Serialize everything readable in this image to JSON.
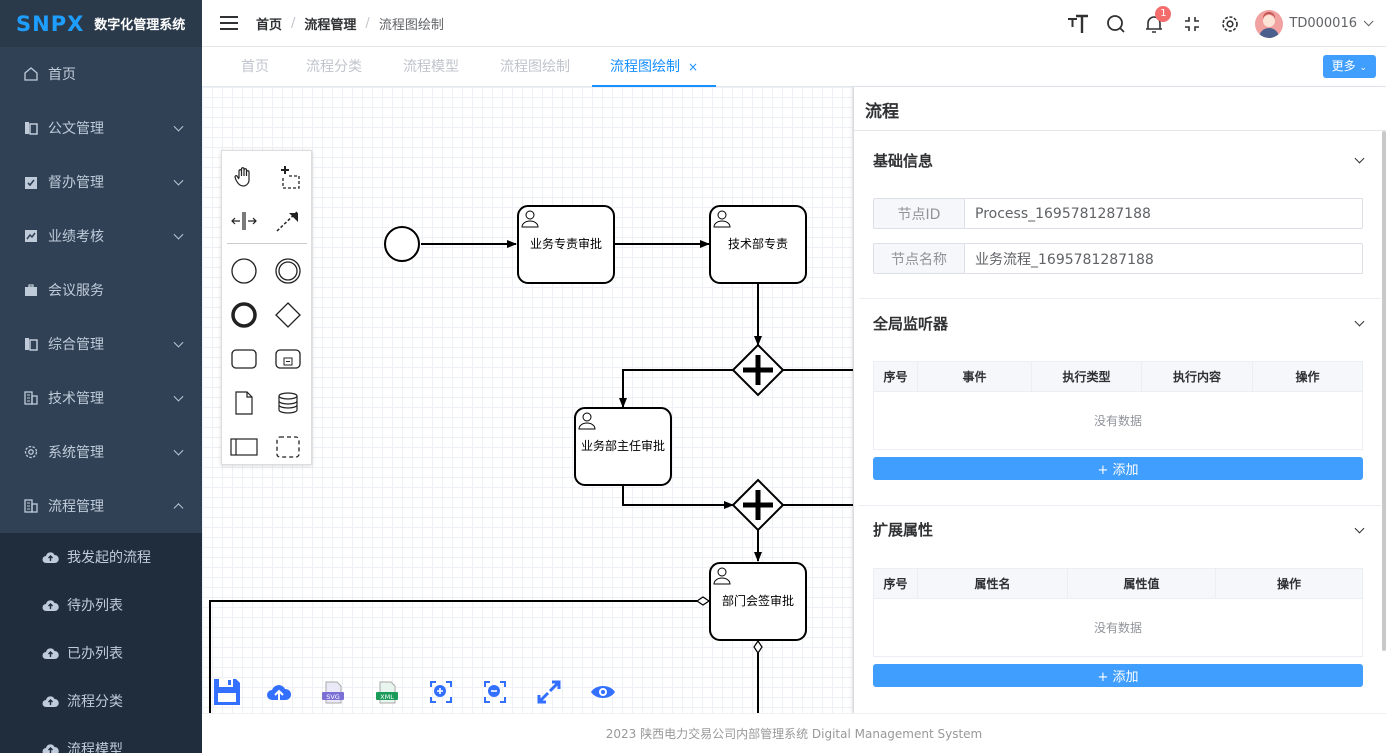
{
  "app": {
    "logo": "SNPX",
    "title": "数字化管理系统"
  },
  "sidebar": {
    "items": [
      {
        "label": "首页",
        "icon": "home-icon"
      },
      {
        "label": "公文管理",
        "icon": "document-icon"
      },
      {
        "label": "督办管理",
        "icon": "clipboard-check-icon"
      },
      {
        "label": "业绩考核",
        "icon": "chart-icon"
      },
      {
        "label": "会议服务",
        "icon": "briefcase-icon"
      },
      {
        "label": "综合管理",
        "icon": "document-icon"
      },
      {
        "label": "技术管理",
        "icon": "building-icon"
      },
      {
        "label": "系统管理",
        "icon": "gear-icon"
      },
      {
        "label": "流程管理",
        "icon": "building-icon"
      }
    ],
    "sub_items": [
      {
        "label": "我发起的流程",
        "icon": "cloud-upload-icon"
      },
      {
        "label": "待办列表",
        "icon": "cloud-upload-icon"
      },
      {
        "label": "已办列表",
        "icon": "cloud-upload-icon"
      },
      {
        "label": "流程分类",
        "icon": "cloud-upload-icon"
      },
      {
        "label": "流程模型",
        "icon": "cloud-upload-icon"
      }
    ]
  },
  "header": {
    "breadcrumb": [
      "首页",
      "流程管理",
      "流程图绘制"
    ],
    "badge_count": "1",
    "username": "TD000016"
  },
  "tabs": {
    "items": [
      "首页",
      "流程分类",
      "流程模型",
      "流程图绘制",
      "流程图绘制"
    ],
    "active_index": 4,
    "close": "×",
    "more_label": "更多"
  },
  "diagram": {
    "tasks": [
      "业务专责审批",
      "技术部专责",
      "业务部主任审批",
      "部门会签审批"
    ]
  },
  "panel": {
    "title": "流程",
    "basic": {
      "title": "基础信息",
      "id_label": "节点ID",
      "id_value": "Process_1695781287188",
      "name_label": "节点名称",
      "name_value": "业务流程_1695781287188"
    },
    "listeners": {
      "title": "全局监听器",
      "columns": [
        "序号",
        "事件",
        "执行类型",
        "执行内容",
        "操作"
      ],
      "empty": "没有数据",
      "add": "+ 添加"
    },
    "ext": {
      "title": "扩展属性",
      "columns": [
        "序号",
        "属性名",
        "属性值",
        "操作"
      ],
      "empty": "没有数据",
      "add": "+ 添加"
    }
  },
  "footer": {
    "text": "2023 陕西电力交易公司内部管理系统 Digital Management System"
  },
  "colors": {
    "sidebar_bg": "#304156",
    "accent": "#1890ff",
    "button": "#409eff",
    "badge": "#f56c6c"
  }
}
